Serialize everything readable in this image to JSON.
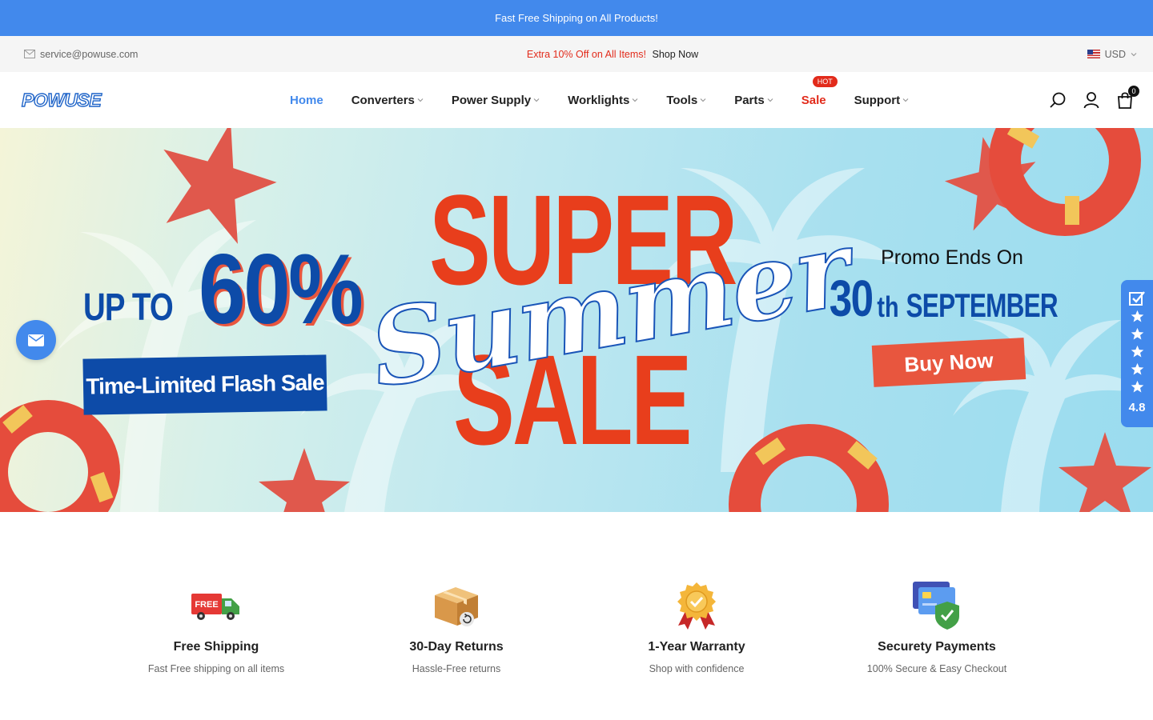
{
  "announcement": {
    "text": "Fast Free Shipping on All Products!"
  },
  "infobar": {
    "email": "service@powuse.com",
    "promo_text": "Extra 10% Off on All Items!",
    "promo_link": "Shop Now",
    "currency": "USD"
  },
  "header": {
    "logo_text": "POWUSE",
    "nav": [
      {
        "label": "Home"
      },
      {
        "label": "Converters"
      },
      {
        "label": "Power Supply"
      },
      {
        "label": "Worklights"
      },
      {
        "label": "Tools"
      },
      {
        "label": "Parts"
      },
      {
        "label": "Sale",
        "badge": "HOT"
      },
      {
        "label": "Support"
      }
    ],
    "cart_count": "0"
  },
  "hero": {
    "upto": "UP TO",
    "percent": "60%",
    "flash_sale": "Time-Limited Flash Sale",
    "super": "SUPER",
    "summer": "Summer",
    "sale": "SALE",
    "promo_ends": "Promo Ends On",
    "date_num": "30",
    "date_suffix": "th",
    "date_month": "SEPTEMBER",
    "buy_now": "Buy Now"
  },
  "reviews": {
    "rating": "4.8"
  },
  "features": [
    {
      "title": "Free Shipping",
      "subtitle": "Fast Free shipping on all items",
      "icon": "free-truck-icon",
      "icon_text": "FREE"
    },
    {
      "title": "30-Day Returns",
      "subtitle": "Hassle-Free returns",
      "icon": "return-box-icon"
    },
    {
      "title": "1-Year Warranty",
      "subtitle": "Shop with confidence",
      "icon": "warranty-medal-icon"
    },
    {
      "title": "Securety Payments",
      "subtitle": "100% Secure & Easy Checkout",
      "icon": "secure-card-icon"
    }
  ],
  "colors": {
    "brand_blue": "#4289ec",
    "sale_red": "#e22b1b",
    "hero_blue": "#0d4ba8",
    "hero_orange": "#e8563e"
  }
}
